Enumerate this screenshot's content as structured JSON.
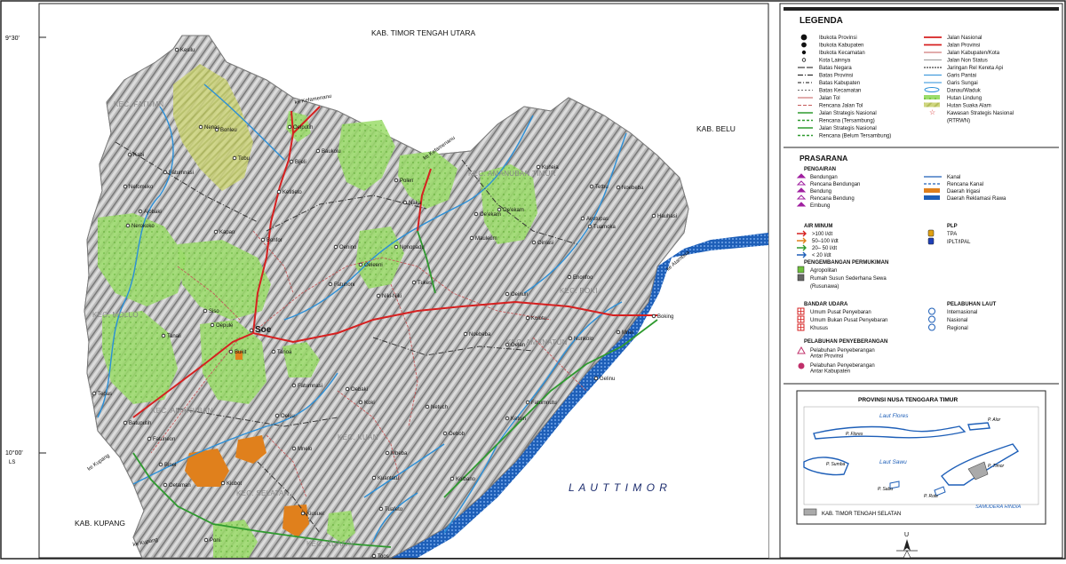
{
  "map": {
    "coords": {
      "lat_top": "9°30'",
      "lat_bottom": "10°00'",
      "ls": "LS"
    },
    "regions": {
      "north": "KAB. TIMOR TENGAH UTARA",
      "east": "KAB. BELU",
      "southwest": "KAB. KUPANG",
      "sea": "L A U T   T I M O R"
    },
    "districts": [
      "KEC. FATUMN",
      "KEC. MOLLO",
      "KEC. AMANUBAN TIMUR",
      "KEC. BOKI",
      "KEC. AMANATUN",
      "KEC. KUALIN",
      "KEC. KUAN",
      "KEC. AMANUBAN",
      "KEC. SELATAN"
    ],
    "places": [
      "Kesilu",
      "Nenas",
      "Bonleu",
      "Oelputih",
      "Kabi",
      "Fatumnasi",
      "Tobu",
      "Bijeli",
      "Baukolu",
      "Nefomeko",
      "Ketitieto",
      "Polen",
      "Naka",
      "Kuheia",
      "Tetbu",
      "Noebeba",
      "Ajobaki",
      "Nerokoko",
      "Kapan",
      "Bonfor",
      "Oenino",
      "Oe'ekam",
      "Nonopadu",
      "Mauleum",
      "Oeleeni",
      "Ayotupas",
      "Tuamoka",
      "Hauhasi",
      "Oinlasi",
      "Fatuhoni",
      "Niki-Niki",
      "Tukes",
      "Oeinun",
      "Enonfoo",
      "Noebeba",
      "Oelan",
      "Siso",
      "Oepule",
      "Soe",
      "Tanali",
      "Bukit",
      "Tanoa",
      "Oebaki",
      "Nunkolo",
      "Boking",
      "Mnei",
      "Fatumnutu",
      "Gelinu",
      "Tepas",
      "Batuputih",
      "Fatuneon",
      "Koki",
      "Netuch",
      "Fatumnasi",
      "Oekiu",
      "Ketoin",
      "Mnelo",
      "Binel",
      "Oetaman",
      "Kiubot",
      "Kuantatu",
      "Kolbano",
      "Kiusuel",
      "Tuafeto",
      "Toos",
      "Poni",
      "Oebob",
      "Mbeba",
      "Kolotu",
      "Oe'ekam"
    ],
    "road_labels": [
      "ke Kefamenanu",
      "ke Kefamenanu",
      "ke Atambua",
      "ke Kupang",
      "ke Kupang"
    ]
  },
  "legend": {
    "title": "LEGENDA",
    "symbols": [
      "Ibukota Provinsi",
      "Ibukota Kabupaten",
      "Ibukota Kecamatan",
      "Kota Lainnya",
      "Batas Negara",
      "Batas Provinsi",
      "Batas Kabupaten",
      "Batas Kecamatan",
      "Jalan Tol",
      "Rencana Jalan Tol",
      "Jalan Strategis Nasional",
      "Rencana (Tersambung)",
      "Jalan Strategis Nasional",
      "Rencana (Belum Tersambung)"
    ],
    "lines": [
      "Jalan Nasional",
      "Jalan Provinsi",
      "Jalan Kabupaten/Kota",
      "Jalan Non Status",
      "Jaringan Rel Kereta Api",
      "Garis Pantai",
      "Garis Sungai",
      "Danau/Waduk",
      "Hutan Lindung",
      "Hutan Suaka Alam",
      "Kawasan Strategis Nasional",
      "(RTRWN)"
    ],
    "prasarana_title": "PRASARANA",
    "pengairan": {
      "title": "PENGAIRAN",
      "items": [
        "Bendungan",
        "Rencana Bendungan",
        "Bendung",
        "Rencana Bendung",
        "Embung"
      ],
      "items_right": [
        "Kanal",
        "Rencana Kanal",
        "Daerah Irigasi",
        "Daerah Reklamasi Rawa"
      ]
    },
    "air_minum": {
      "title": "AIR MINUM",
      "items": [
        ">100 l/dt",
        "50–100 l/dt",
        "20– 50 l/dt",
        "< 20 l/dt"
      ]
    },
    "plp": {
      "title": "PLP",
      "items": [
        "TPA",
        "IPLT/IPAL"
      ]
    },
    "permukiman": {
      "title": "PENGEMBANGAN PERMUKIMAN",
      "items": [
        "Agropolitan",
        "Rumah Susun Sederhana Sewa",
        "(Rusunawa)"
      ]
    },
    "bandara": {
      "title": "BANDAR UDARA",
      "items": [
        "Umum Pusat Penyebaran",
        "Umum Bukan Pusat Penyebaran",
        "Khusus"
      ]
    },
    "pelabuhan_laut": {
      "title": "PELABUHAN LAUT",
      "items": [
        "Internasional",
        "Nasional",
        "Regional"
      ]
    },
    "penyeberangan": {
      "title": "PELABUHAN PENYEBERANGAN",
      "items": [
        "Pelabuhan Penyeberangan",
        "Antar Provinsi",
        "Pelabuhan Penyeberangan",
        "Antar Kabupaten"
      ]
    }
  },
  "inset": {
    "title": "PROVINSI NUSA TENGGARA TIMUR",
    "seas": [
      "Laut Flores",
      "Laut Sawu",
      "SAMUDERA HINDIA"
    ],
    "islands": [
      "P. Flores",
      "P. Alor",
      "P. Sumba",
      "P. Sabu",
      "P. Rote",
      "P. Timor"
    ],
    "caption": "KAB. TIMOR TENGAH SELATAN"
  },
  "north_arrow": "U",
  "colors": {
    "forest": "#9bdc6a",
    "protected_forest": "#c6d17a",
    "irrigation": "#e0801c",
    "sea": "#1e5fb8",
    "national_road": "#d62020",
    "provincial_road": "#2e9a2e",
    "river": "#2a8fd8"
  }
}
